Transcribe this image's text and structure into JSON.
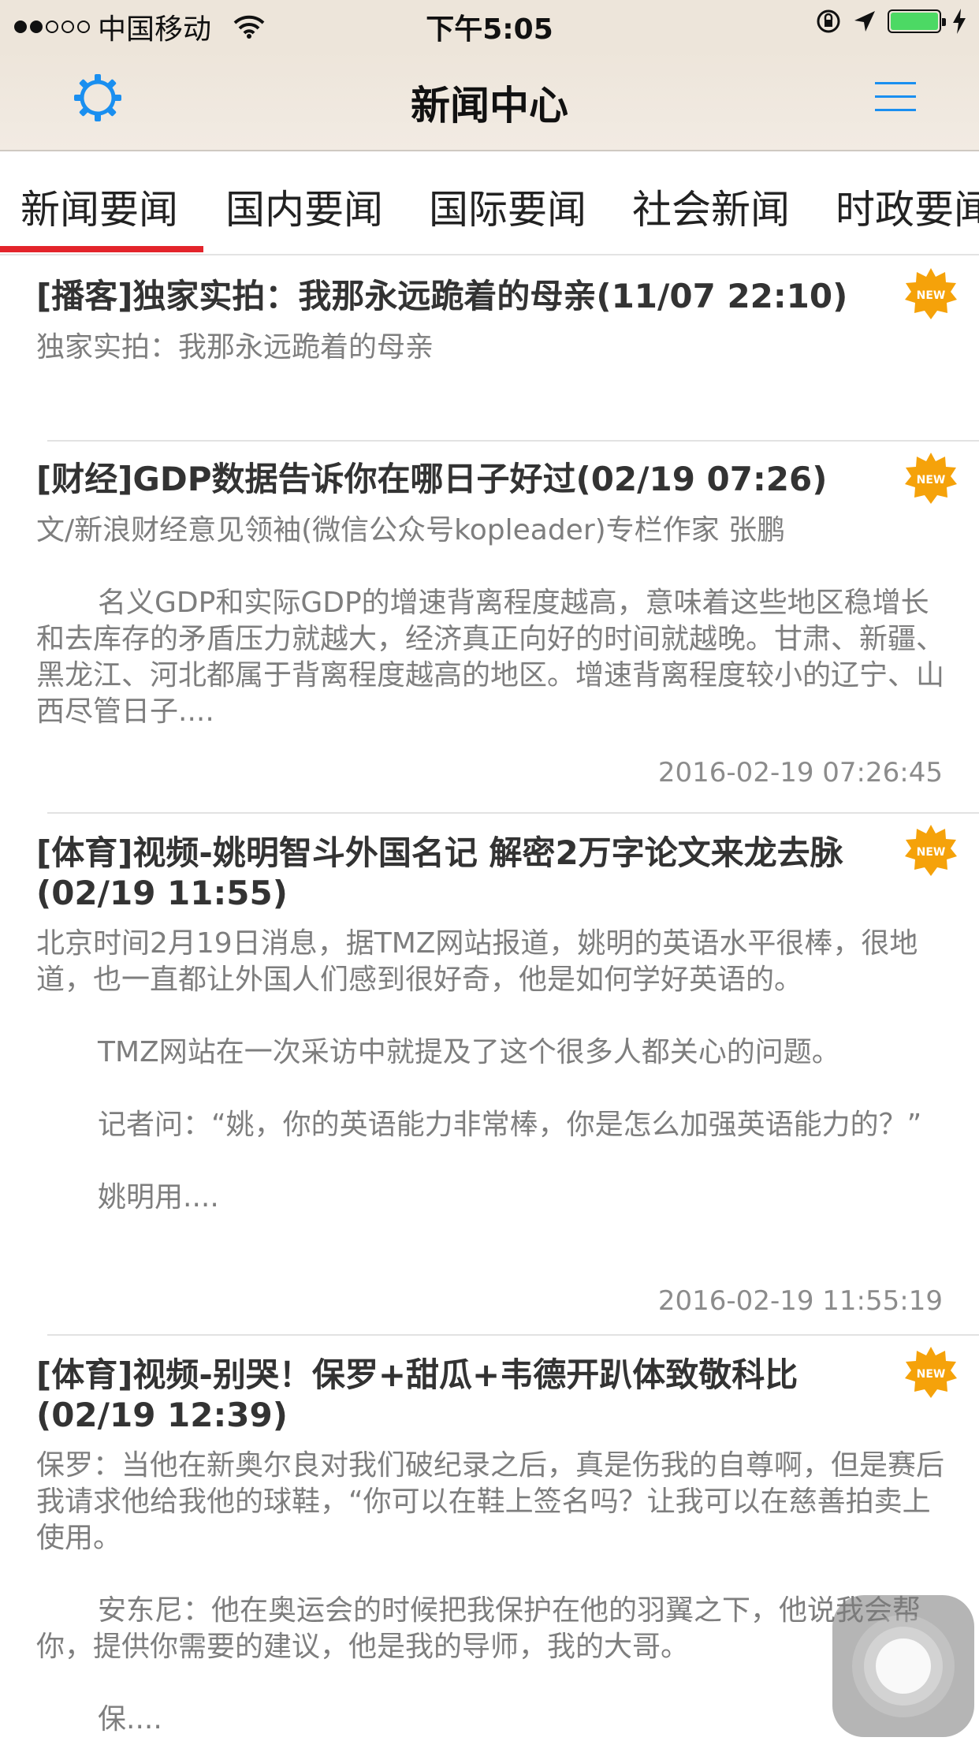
{
  "status_bar": {
    "carrier": "中国移动",
    "time": "下午5:05"
  },
  "header": {
    "title": "新闻中心"
  },
  "tabs": [
    {
      "label": "新闻要闻"
    },
    {
      "label": "国内要闻"
    },
    {
      "label": "国际要闻"
    },
    {
      "label": "社会新闻"
    },
    {
      "label": "时政要闻"
    }
  ],
  "news": [
    {
      "title": "[播客]独家实拍：我那永远跪着的母亲(11/07 22:10)",
      "summary": [
        "独家实拍：我那永远跪着的母亲"
      ],
      "time": "",
      "badge": "NEW"
    },
    {
      "title": "[财经]GDP数据告诉你在哪日子好过(02/19 07:26)",
      "summary": [
        "文/新浪财经意见领袖(微信公众号kopleader)专栏作家 张鹏",
        "名义GDP和实际GDP的增速背离程度越高，意味着这些地区稳增长和去库存的矛盾压力就越大，经济真正向好的时间就越晚。甘肃、新疆、黑龙江、河北都属于背离程度越高的地区。增速背离程度较小的辽宁、山西尽管日子...."
      ],
      "time": "2016-02-19 07:26:45",
      "badge": "NEW"
    },
    {
      "title": "[体育]视频-姚明智斗外国名记 解密2万字论文来龙去脉(02/19 11:55)",
      "summary": [
        "北京时间2月19日消息，据TMZ网站报道，姚明的英语水平很棒，很地道，也一直都让外国人们感到很好奇，他是如何学好英语的。",
        "TMZ网站在一次采访中就提及了这个很多人都关心的问题。",
        "记者问：“姚，你的英语能力非常棒，你是怎么加强英语能力的？”",
        "姚明用...."
      ],
      "time": "2016-02-19 11:55:19",
      "badge": "NEW"
    },
    {
      "title": "[体育]视频-别哭！保罗+甜瓜+韦德开趴体致敬科比(02/19 12:39)",
      "summary": [
        "保罗：当他在新奥尔良对我们破纪录之后，真是伤我的自尊啊，但是赛后我请求他给我他的球鞋，“你可以在鞋上签名吗？让我可以在慈善拍卖上使用。",
        "安东尼：他在奥运会的时候把我保护在他的羽翼之下，他说我会帮你，提供你需要的建议，他是我的导师，我的大哥。",
        "保...."
      ],
      "time": "",
      "badge": "NEW"
    }
  ],
  "colors": {
    "accent": "#e3242b",
    "icon_blue": "#1a8ff0",
    "header_bg": "#ede5da",
    "badge": "#f5a20a"
  },
  "icons": {
    "settings": "gear-icon",
    "menu": "hamburger-menu-icon",
    "badge": "new-badge-icon"
  }
}
